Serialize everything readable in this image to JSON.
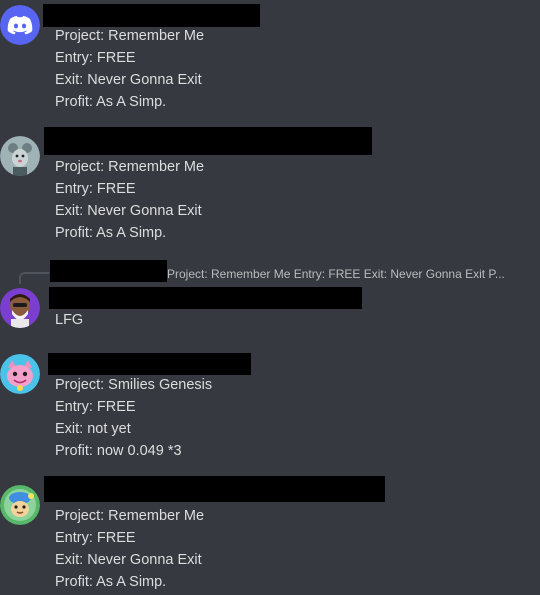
{
  "messages": [
    {
      "avatar_icon": "discord-logo-icon",
      "lines": [
        "Project: Remember Me",
        "Entry: FREE",
        "Exit: Never Gonna Exit",
        "Profit: As A Simp."
      ]
    },
    {
      "avatar_icon": "mouse-character-avatar-icon",
      "lines": [
        "Project: Remember Me",
        "Entry: FREE",
        "Exit: Never Gonna Exit",
        "Profit: As A Simp."
      ]
    },
    {
      "avatar_icon": "bearded-character-avatar-icon",
      "reply_preview": "Project: Remember Me Entry: FREE Exit: Never Gonna Exit P...",
      "lines": [
        "LFG"
      ]
    },
    {
      "avatar_icon": "pink-cat-avatar-icon",
      "lines": [
        "Project: Smilies Genesis",
        "Entry: FREE",
        "Exit: not yet",
        "Profit:  now 0.049 *3"
      ]
    },
    {
      "avatar_icon": "fish-character-avatar-icon",
      "lines": [
        "Project: Remember Me",
        "Entry: FREE",
        "Exit: Never Gonna Exit",
        "Profit: As A Simp."
      ]
    }
  ],
  "colors": {
    "background": "#36393f",
    "text": "#dcddde",
    "muted_text": "#b9bbbe",
    "discord_blurple": "#5865f2",
    "redaction": "#000000"
  }
}
